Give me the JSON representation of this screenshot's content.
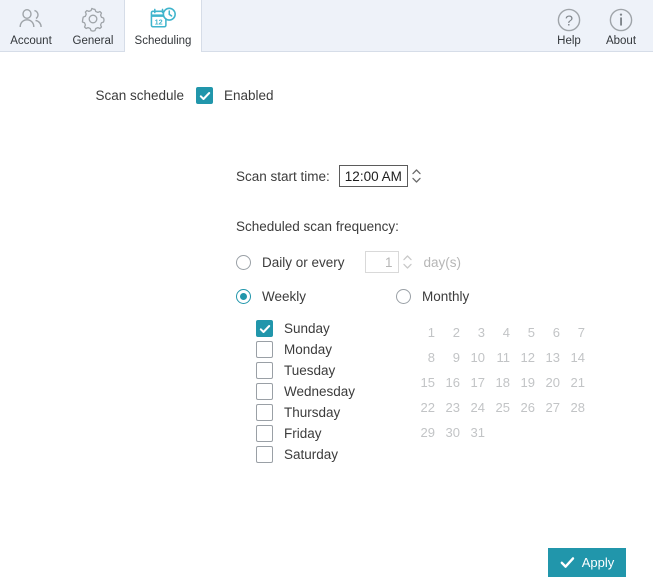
{
  "tabs": [
    {
      "label": "Account",
      "icon": "users-icon",
      "active": false
    },
    {
      "label": "General",
      "icon": "gear-icon",
      "active": false
    },
    {
      "label": "Scheduling",
      "icon": "calendar-clock-icon",
      "active": true
    }
  ],
  "toolbar": [
    {
      "label": "Help",
      "icon": "question-circle-icon"
    },
    {
      "label": "About",
      "icon": "info-circle-icon"
    }
  ],
  "form": {
    "scan_schedule_label": "Scan schedule",
    "enabled_label": "Enabled",
    "enabled_checked": true,
    "scan_start_time_label": "Scan start time:",
    "scan_start_time_value": "12:00 AM",
    "frequency_title": "Scheduled scan frequency:",
    "daily_label": "Daily or every",
    "daily_selected": false,
    "daily_value": "1",
    "daily_unit": "day(s)",
    "weekly_label": "Weekly",
    "weekly_selected": true,
    "monthly_label": "Monthly",
    "monthly_selected": false,
    "weekdays": [
      {
        "label": "Sunday",
        "checked": true
      },
      {
        "label": "Monday",
        "checked": false
      },
      {
        "label": "Tuesday",
        "checked": false
      },
      {
        "label": "Wednesday",
        "checked": false
      },
      {
        "label": "Thursday",
        "checked": false
      },
      {
        "label": "Friday",
        "checked": false
      },
      {
        "label": "Saturday",
        "checked": false
      }
    ],
    "month_days": [
      "1",
      "2",
      "3",
      "4",
      "5",
      "6",
      "7",
      "8",
      "9",
      "10",
      "11",
      "12",
      "13",
      "14",
      "15",
      "16",
      "17",
      "18",
      "19",
      "20",
      "21",
      "22",
      "23",
      "24",
      "25",
      "26",
      "27",
      "28",
      "29",
      "30",
      "31"
    ]
  },
  "apply": {
    "label": "Apply",
    "icon": "check-icon"
  },
  "colors": {
    "accent": "#2196ab",
    "tabbar_bg": "#eef2f9",
    "text": "#3c3c3c",
    "disabled_text": "#b6b6b6",
    "month_day_text": "#c2c4c6"
  }
}
